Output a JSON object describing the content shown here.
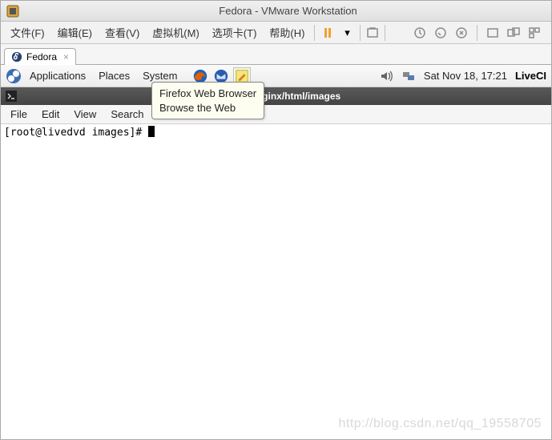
{
  "vmware": {
    "title": "Fedora - VMware Workstation",
    "menu": [
      "文件(F)",
      "编辑(E)",
      "查看(V)",
      "虚拟机(M)",
      "选项卡(T)",
      "帮助(H)"
    ],
    "tab_label": "Fedora"
  },
  "gnome": {
    "menus": [
      "Applications",
      "Places",
      "System"
    ],
    "datetime": "Sat Nov 18, 17:21",
    "livecd": "LiveCI"
  },
  "tooltip": {
    "line1": "Firefox Web Browser",
    "line2": "Browse the Web"
  },
  "terminal": {
    "title_path": "/usr/local/nginx/html/images",
    "menus": [
      "File",
      "Edit",
      "View",
      "Search"
    ],
    "prompt": "[root@livedvd images]# "
  },
  "watermark": "http://blog.csdn.net/qq_19558705"
}
